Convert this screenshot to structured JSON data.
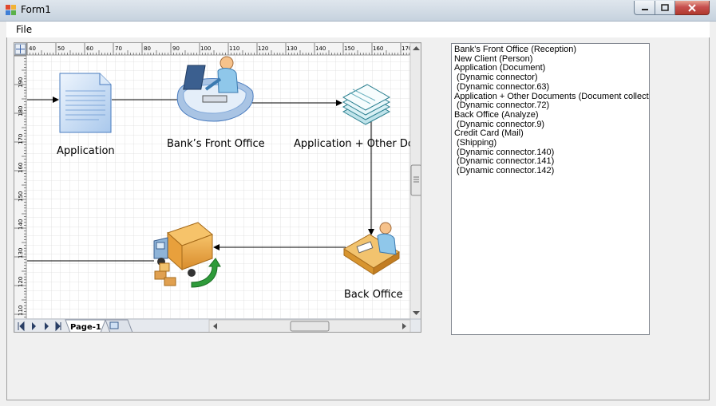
{
  "window": {
    "title": "Form1"
  },
  "menu": {
    "file": "File"
  },
  "diagram": {
    "shapes": {
      "application": "Application",
      "front_office": "Bank’s Front Office",
      "documents": "Application + Other Doc",
      "back_office": "Back Office"
    },
    "ruler_top": [
      "40",
      "50",
      "60",
      "70",
      "80",
      "90",
      "100",
      "110",
      "120",
      "130",
      "140",
      "150",
      "160",
      "170"
    ],
    "ruler_left": [
      "190",
      "180",
      "170",
      "160",
      "150",
      "140",
      "130",
      "120",
      "110"
    ],
    "page_tab": "Page-1"
  },
  "event_log": {
    "lines": [
      "Bank’s Front Office (Reception)",
      "New Client (Person)",
      "Application (Document)",
      " (Dynamic connector)",
      " (Dynamic connector.63)",
      "Application + Other Documents (Document collection)",
      " (Dynamic connector.72)",
      "Back Office (Analyze)",
      " (Dynamic connector.9)",
      "Credit Card (Mail)",
      " (Shipping)",
      " (Dynamic connector.140)",
      " (Dynamic connector.141)",
      " (Dynamic connector.142)"
    ]
  },
  "colors": {
    "accent_close": "#c75050",
    "ruler": "#f4f4f4",
    "grid": "#dcdcdc",
    "arrow_green": "#2e9b3a"
  }
}
